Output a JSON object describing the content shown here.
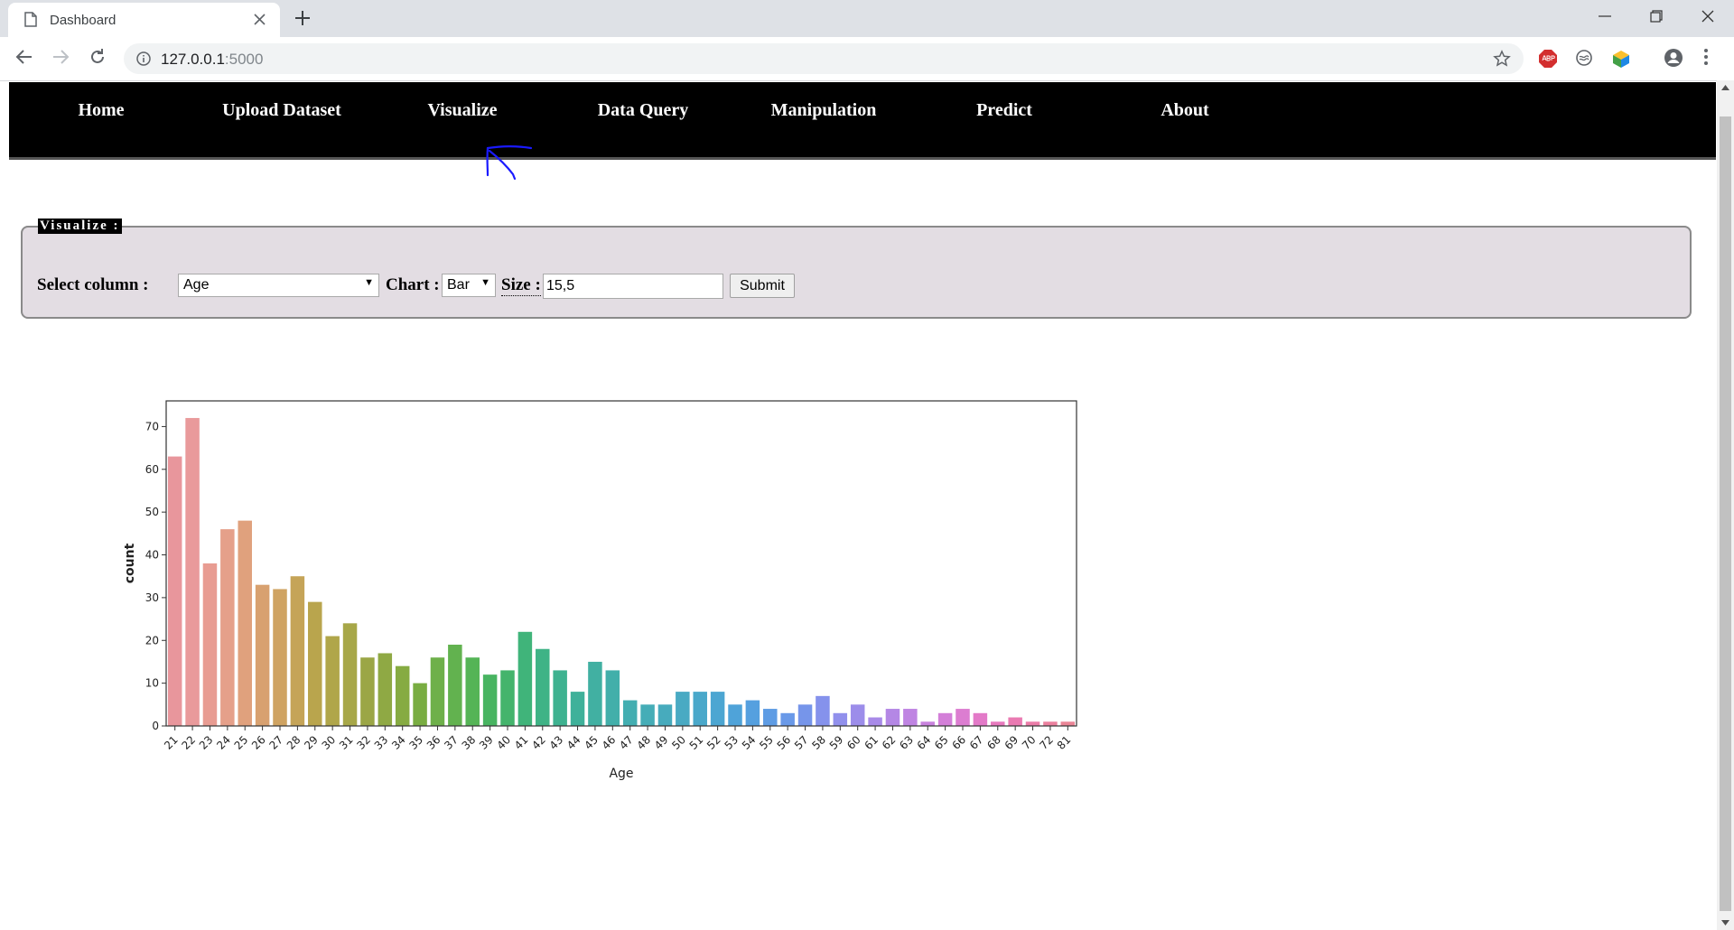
{
  "browser": {
    "tab_title": "Dashboard",
    "url_host": "127.0.0.1",
    "url_port": ":5000"
  },
  "nav": {
    "items": [
      "Home",
      "Upload Dataset",
      "Visualize",
      "Data Query",
      "Manipulation",
      "Predict",
      "About"
    ]
  },
  "panel": {
    "legend": "Visualize :",
    "column_label": "Select column :",
    "column_value": "Age",
    "chart_label": "Chart :",
    "chart_value": "Bar",
    "size_label": "Size :",
    "size_value": "15,5",
    "submit_label": "Submit"
  },
  "chart_data": {
    "type": "bar",
    "xlabel": "Age",
    "ylabel": "count",
    "ylim": [
      0,
      76
    ],
    "yticks": [
      0,
      10,
      20,
      30,
      40,
      50,
      60,
      70
    ],
    "categories": [
      "21",
      "22",
      "23",
      "24",
      "25",
      "26",
      "27",
      "28",
      "29",
      "30",
      "31",
      "32",
      "33",
      "34",
      "35",
      "36",
      "37",
      "38",
      "39",
      "40",
      "41",
      "42",
      "43",
      "44",
      "45",
      "46",
      "47",
      "48",
      "49",
      "50",
      "51",
      "52",
      "53",
      "54",
      "55",
      "56",
      "57",
      "58",
      "59",
      "60",
      "61",
      "62",
      "63",
      "64",
      "65",
      "66",
      "67",
      "68",
      "69",
      "70",
      "72",
      "81"
    ],
    "values": [
      63,
      72,
      38,
      46,
      48,
      33,
      32,
      35,
      29,
      21,
      24,
      16,
      17,
      14,
      10,
      16,
      19,
      16,
      12,
      13,
      22,
      18,
      13,
      8,
      15,
      13,
      6,
      5,
      5,
      8,
      8,
      8,
      5,
      6,
      4,
      3,
      5,
      7,
      3,
      5,
      2,
      4,
      4,
      1,
      3,
      4,
      3,
      1,
      2,
      1,
      1,
      1
    ],
    "colors": [
      "#e8969c",
      "#e99a9b",
      "#e89c92",
      "#e5a08a",
      "#e0a17d",
      "#d8a170",
      "#cfa362",
      "#c5a458",
      "#b9a54d",
      "#b0a64a",
      "#a7a748",
      "#9ba646",
      "#8fa944",
      "#86ab42",
      "#79ad42",
      "#6eb04a",
      "#62b24f",
      "#55b456",
      "#48b461",
      "#44b46c",
      "#40b47a",
      "#3fb386",
      "#3eb290",
      "#3fb19a",
      "#41b0a2",
      "#42afaa",
      "#43aeb1",
      "#45adb7",
      "#47abbd",
      "#49aac3",
      "#4aa8ca",
      "#4ca6d2",
      "#4fa3d9",
      "#55a0df",
      "#5e9ce4",
      "#6999e8",
      "#7695ea",
      "#8592ec",
      "#9190ec",
      "#9c8dea",
      "#a88ae8",
      "#b487e5",
      "#bf84e2",
      "#c982de",
      "#d37fd8",
      "#dc7dd1",
      "#e37ac8",
      "#e879be",
      "#ea7ab2",
      "#eb7ca8",
      "#eb809e",
      "#ea8596"
    ]
  }
}
